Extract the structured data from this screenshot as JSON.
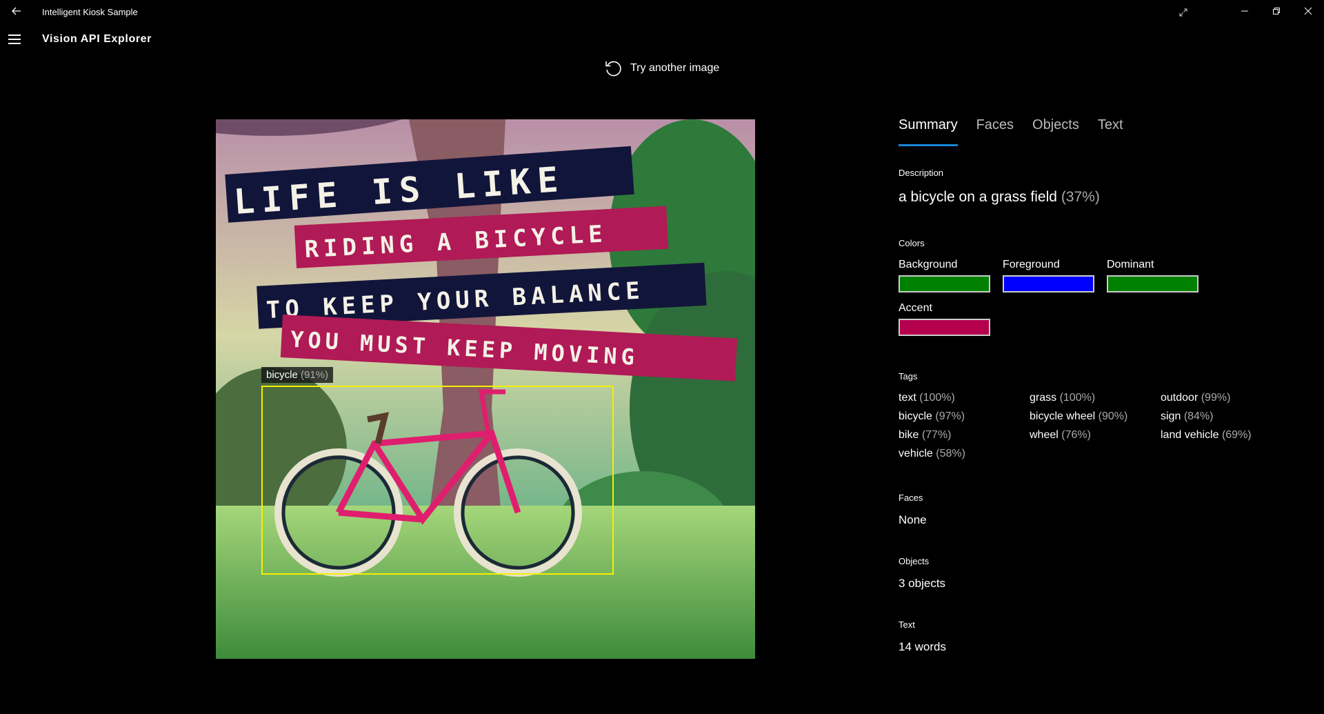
{
  "window": {
    "title": "Intelligent Kiosk Sample"
  },
  "header": {
    "page_title": "Vision API Explorer"
  },
  "toolbar": {
    "try_another_label": "Try another image"
  },
  "image": {
    "detected_object": {
      "label": "bicycle",
      "confidence": "(91%)"
    },
    "poster_lines": [
      "LIFE IS LIKE",
      "RIDING A BICYCLE",
      "TO KEEP YOUR BALANCE",
      "YOU MUST KEEP MOVING"
    ]
  },
  "tabs": [
    {
      "label": "Summary",
      "active": true
    },
    {
      "label": "Faces",
      "active": false
    },
    {
      "label": "Objects",
      "active": false
    },
    {
      "label": "Text",
      "active": false
    }
  ],
  "summary": {
    "description_label": "Description",
    "description_text": "a bicycle on a grass field",
    "description_confidence": "(37%)",
    "colors_label": "Colors",
    "colors": [
      {
        "name": "Background",
        "hex": "#008000"
      },
      {
        "name": "Foreground",
        "hex": "#0000ff"
      },
      {
        "name": "Dominant",
        "hex": "#008000"
      },
      {
        "name": "Accent",
        "hex": "#b5004d"
      }
    ],
    "tags_label": "Tags",
    "tags": [
      {
        "name": "text",
        "confidence": "(100%)"
      },
      {
        "name": "grass",
        "confidence": "(100%)"
      },
      {
        "name": "outdoor",
        "confidence": "(99%)"
      },
      {
        "name": "bicycle",
        "confidence": "(97%)"
      },
      {
        "name": "bicycle wheel",
        "confidence": "(90%)"
      },
      {
        "name": "sign",
        "confidence": "(84%)"
      },
      {
        "name": "bike",
        "confidence": "(77%)"
      },
      {
        "name": "wheel",
        "confidence": "(76%)"
      },
      {
        "name": "land vehicle",
        "confidence": "(69%)"
      },
      {
        "name": "vehicle",
        "confidence": "(58%)"
      }
    ],
    "faces_label": "Faces",
    "faces_value": "None",
    "objects_label": "Objects",
    "objects_value": "3 objects",
    "text_label": "Text",
    "text_value": "14 words"
  }
}
